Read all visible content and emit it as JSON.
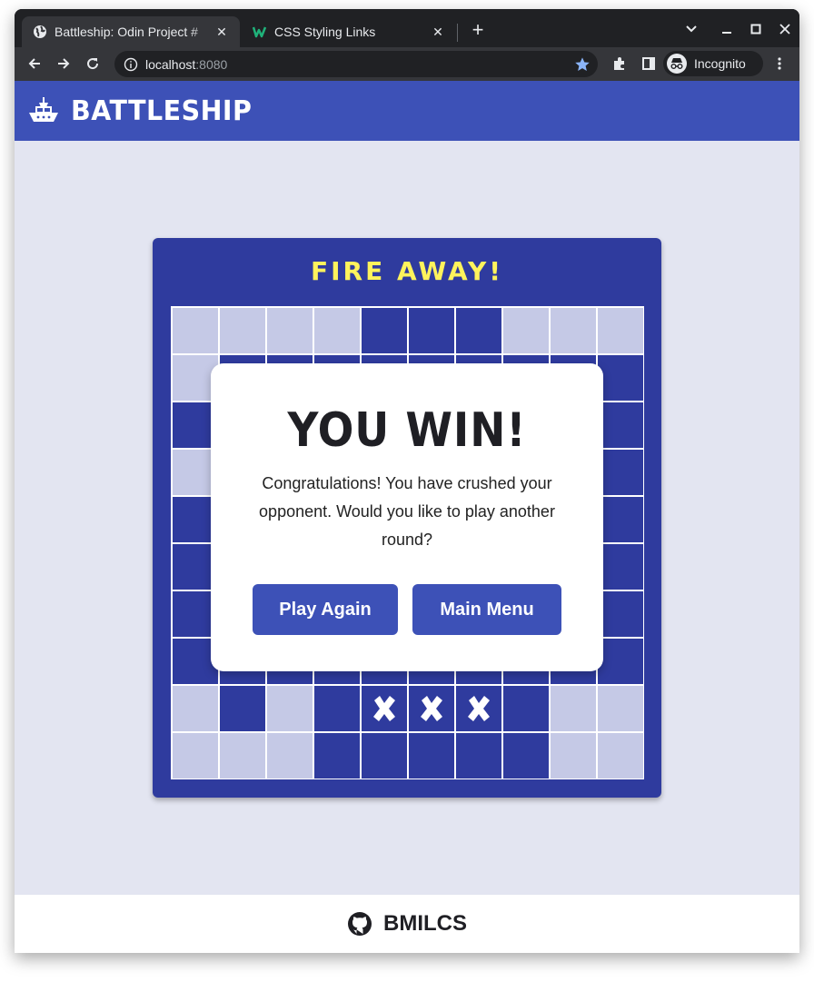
{
  "browser": {
    "tabs": [
      {
        "title": "Battleship: Odin Project #",
        "icon": "globe-icon",
        "active": true
      },
      {
        "title": "CSS Styling Links",
        "icon": "w-logo-icon",
        "active": false
      }
    ],
    "new_tab_icon": "plus-icon",
    "address": {
      "host": "localhost",
      "port": ":8080"
    },
    "profile_label": "Incognito"
  },
  "header": {
    "title": "BATTLESHIP",
    "logo_icon": "ship-icon"
  },
  "board": {
    "title": "FIRE AWAY!",
    "rows": [
      [
        "L",
        "L",
        "L",
        "L",
        "W",
        "W",
        "W",
        "L",
        "L",
        "L"
      ],
      [
        "L",
        "W",
        "W",
        "W",
        "W",
        "W",
        "W",
        "W",
        "W",
        "W"
      ],
      [
        "W",
        "W",
        "W",
        "W",
        "W",
        "W",
        "W",
        "W",
        "W",
        "W"
      ],
      [
        "L",
        "W",
        "W",
        "W",
        "W",
        "W",
        "W",
        "W",
        "W",
        "W"
      ],
      [
        "W",
        "W",
        "W",
        "W",
        "W",
        "W",
        "W",
        "W",
        "W",
        "W"
      ],
      [
        "W",
        "W",
        "W",
        "W",
        "W",
        "W",
        "W",
        "W",
        "W",
        "W"
      ],
      [
        "W",
        "W",
        "W",
        "W",
        "W",
        "W",
        "W",
        "W",
        "W",
        "W"
      ],
      [
        "W",
        "W",
        "W",
        "W",
        "W",
        "W",
        "W",
        "W",
        "W",
        "W"
      ],
      [
        "L",
        "W",
        "L",
        "W",
        "X",
        "X",
        "X",
        "W",
        "L",
        "L"
      ],
      [
        "L",
        "L",
        "L",
        "W",
        "W",
        "W",
        "W",
        "W",
        "L",
        "L"
      ]
    ]
  },
  "modal": {
    "title": "YOU WIN!",
    "message": "Congratulations! You have crushed your opponent. Would you like to play another round?",
    "play_again": "Play Again",
    "main_menu": "Main Menu"
  },
  "footer": {
    "handle": "BMILCS",
    "icon": "github-icon"
  },
  "colors": {
    "primary": "#3d51b7",
    "board": "#2f3b9e",
    "accent": "#fff35c",
    "miss": "#c5c9e6"
  }
}
